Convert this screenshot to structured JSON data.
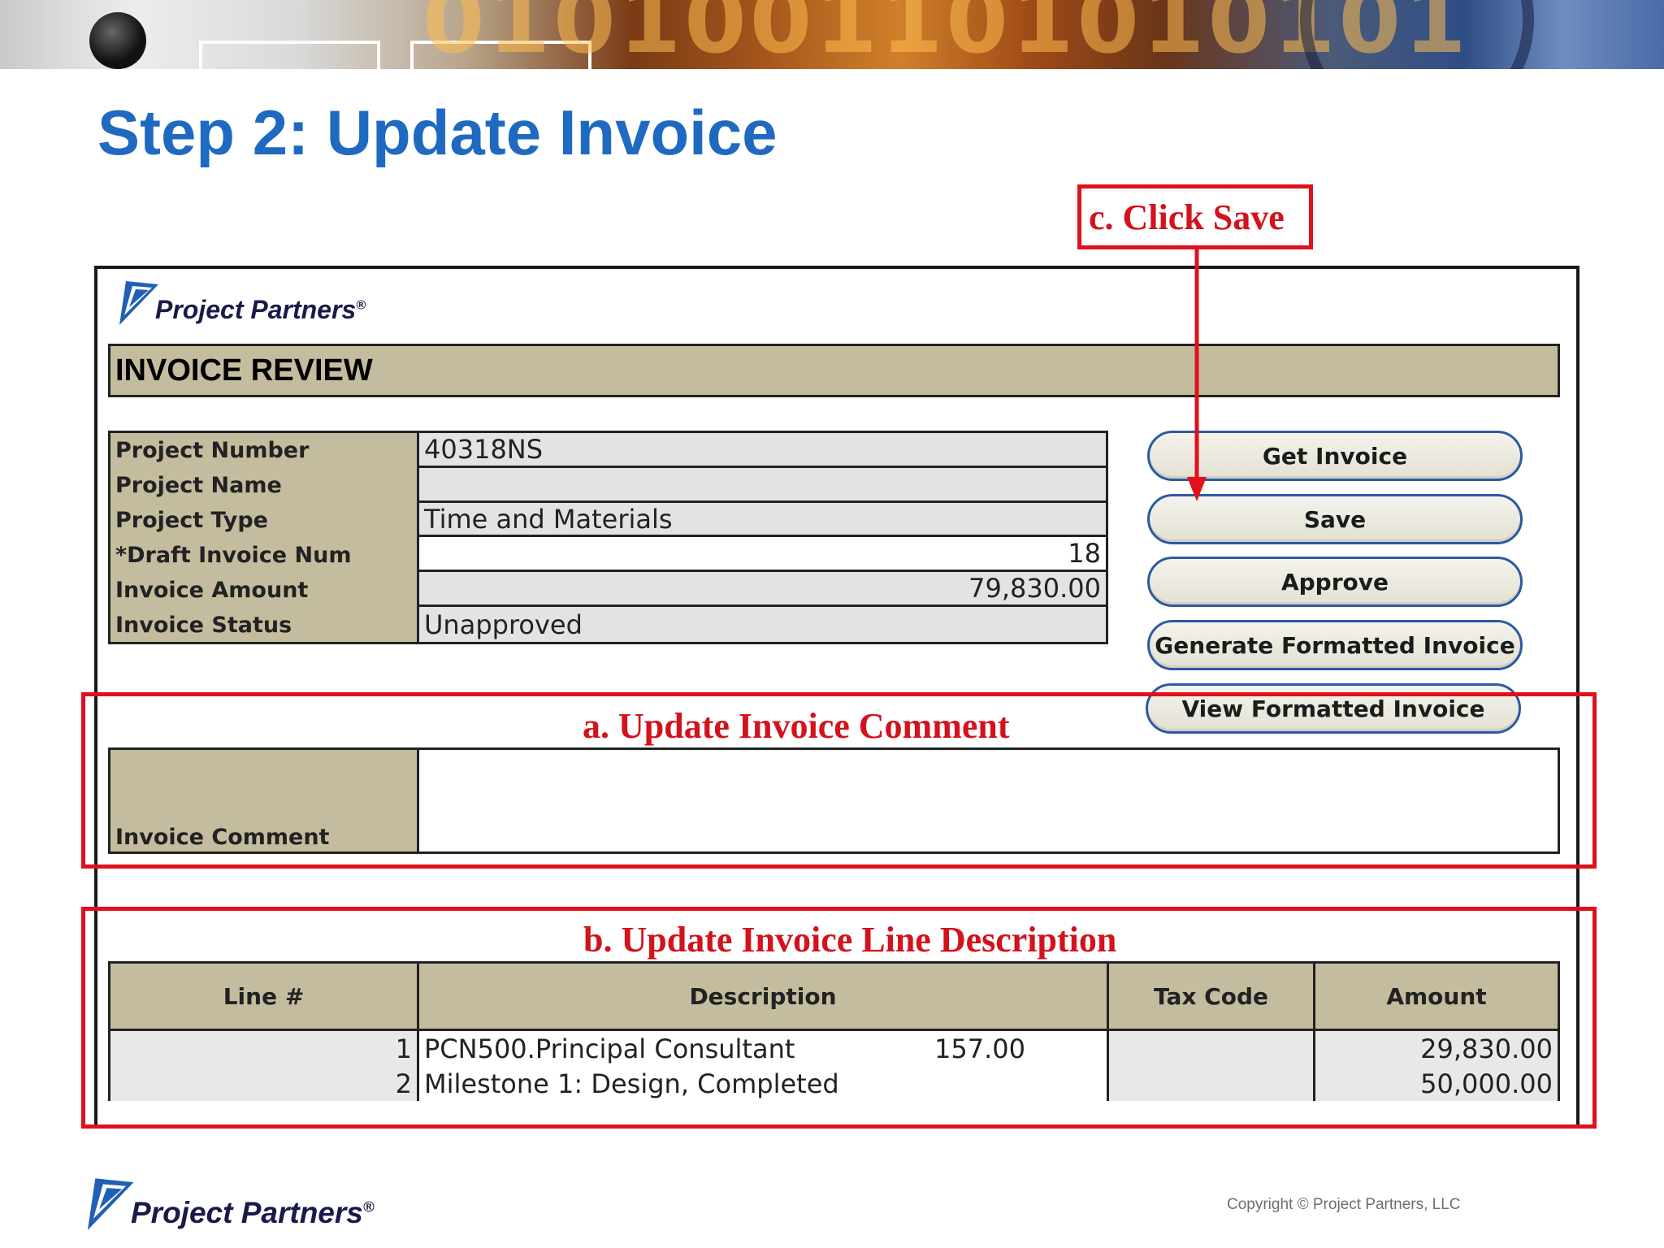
{
  "slide": {
    "title": "Step 2: Update Invoice",
    "copyright": "Copyright © Project Partners, LLC"
  },
  "brand": {
    "logo_text": "Project Partners",
    "logo_mark": "®"
  },
  "annotations": {
    "a": "a. Update Invoice Comment",
    "b": "b. Update Invoice Line Description",
    "c": "c. Click Save",
    "accent_color": "#e0111d"
  },
  "app": {
    "header": "INVOICE REVIEW",
    "fields": [
      {
        "label": "Project Number",
        "value": "40318NS"
      },
      {
        "label": "Project Name",
        "value": ""
      },
      {
        "label": "Project Type",
        "value": "Time and Materials"
      },
      {
        "label": "*Draft Invoice Num",
        "value": "18"
      },
      {
        "label": "Invoice Amount",
        "value": "79,830.00"
      },
      {
        "label": "Invoice Status",
        "value": "Unapproved"
      }
    ],
    "buttons": {
      "get_invoice": "Get Invoice",
      "save": "Save",
      "approve": "Approve",
      "generate": "Generate Formatted Invoice",
      "view": "View Formatted Invoice"
    },
    "comment": {
      "label": "Invoice Comment",
      "value": ""
    },
    "lines": {
      "columns": [
        "Line #",
        "Description",
        "Tax Code",
        "Amount"
      ],
      "rows": [
        {
          "line": "1",
          "description": "PCN500.Principal Consultant",
          "rate": "157.00",
          "tax_code": "",
          "amount": "29,830.00"
        },
        {
          "line": "2",
          "description": "Milestone 1: Design, Completed",
          "rate": "",
          "tax_code": "",
          "amount": "50,000.00"
        }
      ]
    }
  },
  "colors": {
    "title_blue": "#1f6ac0",
    "label_tan": "#c4bc9e",
    "button_border": "#2c5aa0"
  }
}
